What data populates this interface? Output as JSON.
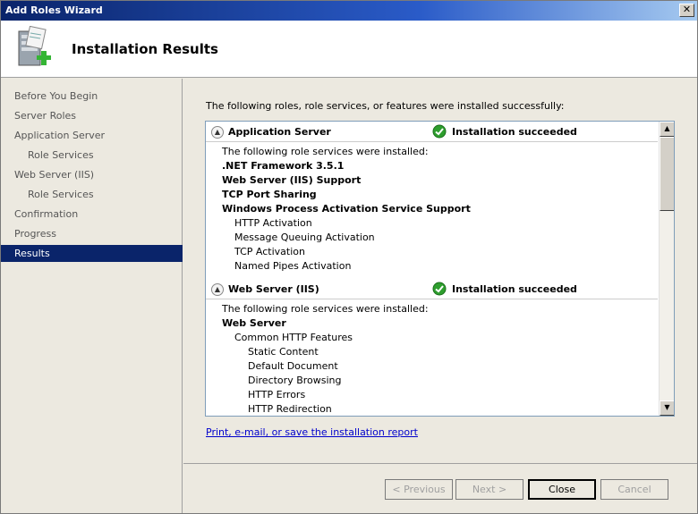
{
  "window": {
    "title": "Add Roles Wizard",
    "close_glyph": "✕"
  },
  "header": {
    "title": "Installation Results",
    "icon": "server-add-icon"
  },
  "sidebar": {
    "items": [
      {
        "label": "Before You Begin"
      },
      {
        "label": "Server Roles"
      },
      {
        "label": "Application Server"
      },
      {
        "label": "Role Services"
      },
      {
        "label": "Web Server (IIS)"
      },
      {
        "label": "Role Services"
      },
      {
        "label": "Confirmation"
      },
      {
        "label": "Progress"
      },
      {
        "label": "Results"
      }
    ]
  },
  "content": {
    "intro": "The following roles, role services, or features were installed successfully:",
    "sections": [
      {
        "name": "Application Server",
        "status": "Installation succeeded",
        "lines": [
          "The following role services were installed:",
          ".NET Framework 3.5.1",
          "Web Server (IIS) Support",
          "TCP Port Sharing",
          "Windows Process Activation Service Support",
          "HTTP Activation",
          "Message Queuing Activation",
          "TCP Activation",
          "Named Pipes Activation"
        ]
      },
      {
        "name": "Web Server (IIS)",
        "status": "Installation succeeded",
        "lines": [
          "The following role services were installed:",
          "Web Server",
          "Common HTTP Features",
          "Static Content",
          "Default Document",
          "Directory Browsing",
          "HTTP Errors",
          "HTTP Redirection"
        ]
      }
    ],
    "report_link": "Print, e-mail, or save the installation report"
  },
  "buttons": {
    "previous": "< Previous",
    "next": "Next >",
    "close": "Close",
    "cancel": "Cancel"
  },
  "colors": {
    "accent": "#0a246a",
    "success": "#2e9e2e",
    "link": "#0000cc"
  }
}
